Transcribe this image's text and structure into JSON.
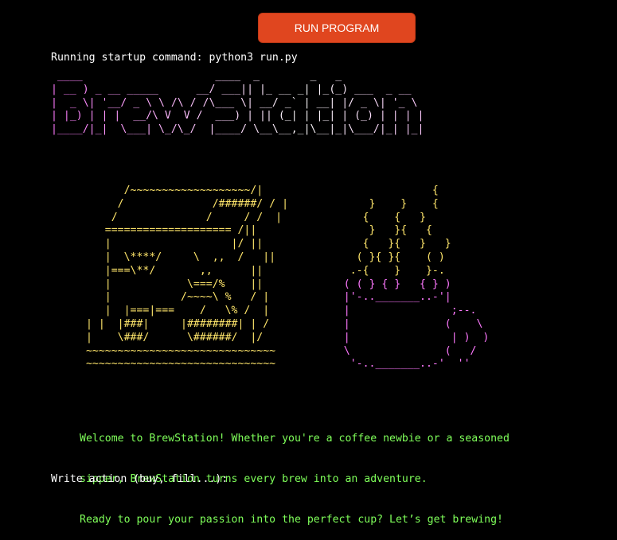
{
  "toolbar": {
    "run_label": "RUN PROGRAM"
  },
  "terminal": {
    "startup_line": "Running startup command: python3 run.py",
    "logo_art": " ____                     ____  _        _   _             \n| __ ) _ __ _____      __/ ___|| |_ __ _| |_(_) ___  _ __  \n|  _ \\| '__/ _ \\ \\ /\\ / /\\___ \\| __/ _` | __| |/ _ \\| '_ \\ \n| |_) | | |  __/\\ V  V /  ___) | || (_| | |_| | (_) | | | |\n|____/|_|  \\___| \\_/\\_/  |____/ \\__\\__,_|\\__|_|\\___/|_| |_|",
    "machine_art": "       /~~~~~~~~~~~~~~~~~~~/|\n      /              /######/ / |\n     /              /     / /  |\n    ==================== /||\n    |                   |/ ||\n    |  \\****/     \\  ,,  /   ||\n    |===\\**/       ,,      ||\n    |            \\===/%    ||\n    |           /~~~~\\ %   / |\n    |  |===|===    /   \\% /  |\n | |  |###|     |########| | /\n |    \\###/      \\######/  |/\n ~~~~~~~~~~~~~~~~~~~~~~~~~~~~~~\n ~~~~~~~~~~~~~~~~~~~~~~~~~~~~~~",
    "steam_art": "                  {\n        }    }    {\n       {    {   }\n        }   }{   {\n       {   }{   }   }\n      ( }{ }{    ( )\n     .-{    }    }-.",
    "cup_art": "    ( ( } { }   { } )\n    |'-.._______..-'|\n    |                ;--.\n    |               (    \\\n    |                | )  )\n    \\               (   /\n     '-.._______..-'  ''",
    "welcome_lines": [
      "Welcome to BrewStation! Whether you're a coffee newbie or a seasoned",
      "sipper, BrewStation turns every brew into an adventure.",
      "Ready to pour your passion into the perfect cup? Let’s get brewing!"
    ],
    "prompt": "Write action (buy, fill...):"
  },
  "colors": {
    "background": "#000000",
    "button": "#e0461f",
    "logo": "#ff78ff",
    "machine": "#ffe66b",
    "welcome": "#7fff5a"
  }
}
